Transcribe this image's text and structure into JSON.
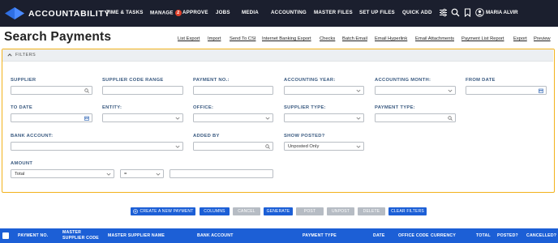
{
  "app": {
    "logo_text": "ACCOUNTABILITY"
  },
  "nav": {
    "items": [
      "TIME & TASKS",
      "MANAGE",
      "APPROVE",
      "JOBS",
      "MEDIA",
      "ACCOUNTING",
      "MASTER FILES",
      "SET UP FILES",
      "QUICK ADD"
    ],
    "manage_badge": "2",
    "user_name": "MARIA ALVIR"
  },
  "page": {
    "title": "Search Payments"
  },
  "actions": [
    "List Export",
    "Import",
    "Send To CSI",
    "Internet Banking Export",
    "Checks",
    "Batch Email",
    "Email Hyperlink",
    "Email Attachments",
    "Payment List Report",
    "Export",
    "Preview"
  ],
  "filters": {
    "header": "FILTERS",
    "supplier": {
      "label": "SUPPLIER",
      "value": ""
    },
    "supplier_code_range": {
      "label": "SUPPLIER CODE RANGE",
      "value": ""
    },
    "payment_no": {
      "label": "PAYMENT NO.:",
      "value": ""
    },
    "accounting_year": {
      "label": "ACCOUNTING YEAR:",
      "value": ""
    },
    "accounting_month": {
      "label": "ACCOUNTING MONTH:",
      "value": ""
    },
    "from_date": {
      "label": "FROM DATE",
      "value": ""
    },
    "to_date": {
      "label": "TO DATE",
      "value": ""
    },
    "entity": {
      "label": "ENTITY:",
      "value": ""
    },
    "office": {
      "label": "OFFICE:",
      "value": ""
    },
    "supplier_type": {
      "label": "SUPPLIER TYPE:",
      "value": ""
    },
    "payment_type": {
      "label": "PAYMENT TYPE:",
      "value": ""
    },
    "bank_account": {
      "label": "BANK ACCOUNT:",
      "value": ""
    },
    "added_by": {
      "label": "ADDED BY",
      "value": ""
    },
    "show_posted": {
      "label": "SHOW POSTED?",
      "value": "Unposted Only"
    },
    "amount": {
      "label": "AMOUNT",
      "mode": "Total",
      "operator": "=",
      "value": ""
    }
  },
  "buttons": {
    "create": "CREATE A NEW PAYMENT",
    "columns": "COLUMNS",
    "cancel": "CANCEL",
    "generate": "GENERATE",
    "post": "POST",
    "unpost": "UNPOST",
    "delete": "DELETE",
    "clear_filters": "CLEAR FILTERS"
  },
  "table": {
    "columns": [
      "PAYMENT NO.",
      "MASTER SUPPLIER CODE",
      "MASTER SUPPLIER NAME",
      "BANK ACCOUNT",
      "PAYMENT TYPE",
      "DATE",
      "OFFICE CODE",
      "CURRENCY",
      "TOTAL",
      "POSTED?",
      "CANCELLED?"
    ]
  },
  "colors": {
    "nav_bg": "#1b1f2e",
    "accent": "#1c5fd6",
    "filter_border": "#f2b21b",
    "label": "#3a5a80"
  }
}
